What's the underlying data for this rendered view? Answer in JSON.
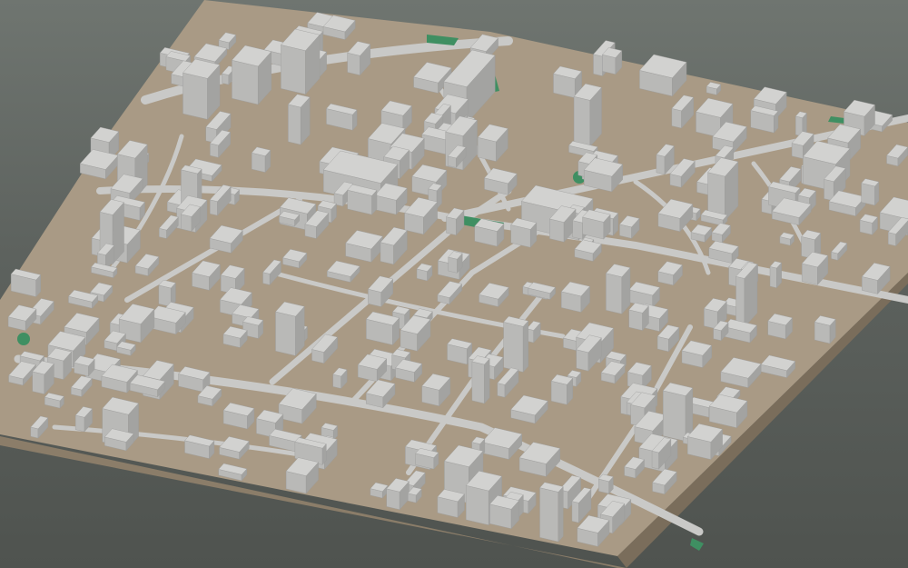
{
  "scene": {
    "kind": "3d-city-block-model",
    "view": "isometric-oblique",
    "colors": {
      "background_top": "#6f7570",
      "background_bottom": "#4f534f",
      "ground_top": "#a99a85",
      "base_side_left": "#8b7d69",
      "base_side_front": "#7a6d5b",
      "road": "#c9c9c7",
      "building_top": "#d2d2d0",
      "building_left": "#b9b9b7",
      "building_right": "#a3a3a1",
      "park": "#3f8f62"
    }
  }
}
